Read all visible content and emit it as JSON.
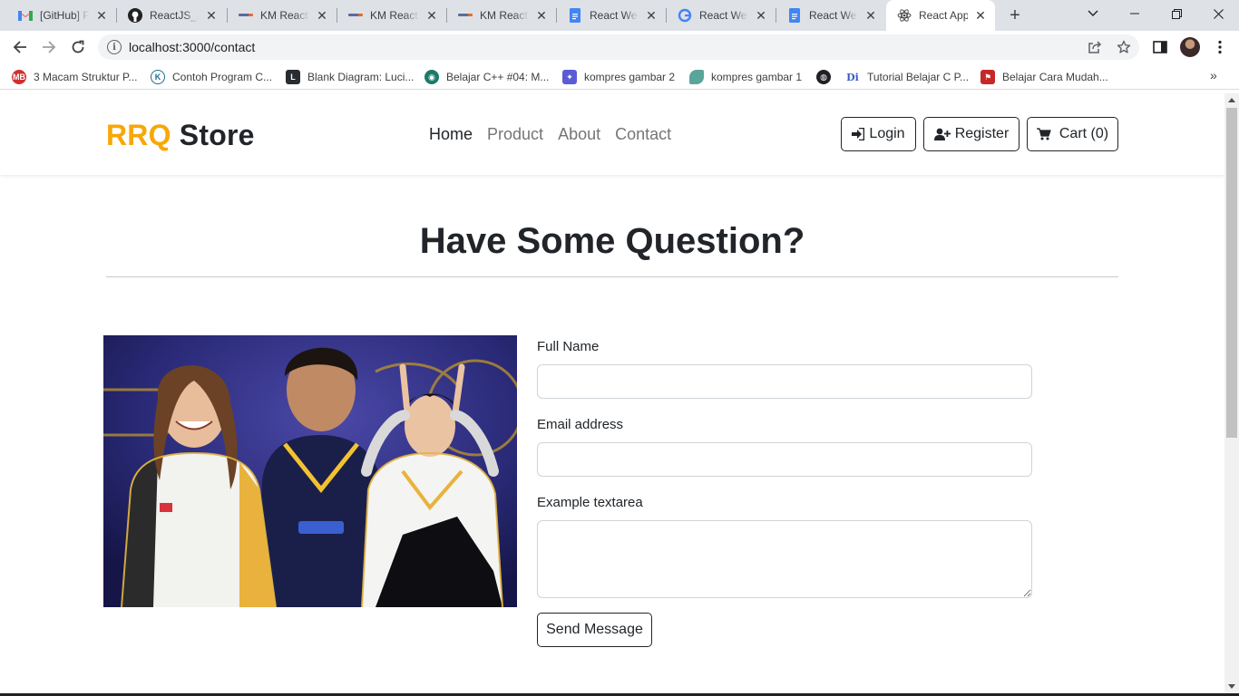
{
  "browser": {
    "tabs": [
      {
        "title": "[GitHub] P",
        "icon": "gmail-icon"
      },
      {
        "title": "ReactJS_Ar",
        "icon": "github-icon"
      },
      {
        "title": "KM React V",
        "icon": "site-logo-icon"
      },
      {
        "title": "KM React V",
        "icon": "site-logo-icon"
      },
      {
        "title": "KM React V",
        "icon": "site-logo-icon"
      },
      {
        "title": "React Wee",
        "icon": "google-docs-icon"
      },
      {
        "title": "React Wee",
        "icon": "google-icon"
      },
      {
        "title": "React Wee",
        "icon": "google-docs-icon"
      },
      {
        "title": "React App",
        "icon": "react-icon",
        "active": true
      }
    ],
    "url": "localhost:3000/contact",
    "bookmarks": [
      {
        "label": "3 Macam Struktur P...",
        "icon": "mb-icon"
      },
      {
        "label": "Contoh Program C...",
        "icon": "k-icon"
      },
      {
        "label": "Blank Diagram: Luci...",
        "icon": "lucid-icon"
      },
      {
        "label": "Belajar C++ #04: M...",
        "icon": "petani-icon"
      },
      {
        "label": "kompres gambar 2",
        "icon": "compress-icon"
      },
      {
        "label": "kompres gambar 1",
        "icon": "leaf-icon"
      },
      {
        "label": "",
        "icon": "globe-icon"
      },
      {
        "label": "Tutorial Belajar C P...",
        "icon": "di-icon"
      },
      {
        "label": "Belajar Cara Mudah...",
        "icon": "red-flag-icon"
      }
    ]
  },
  "site": {
    "brand_accent": "RRQ",
    "brand_rest": " Store",
    "nav": [
      {
        "label": "Home",
        "active": true
      },
      {
        "label": "Product",
        "active": false
      },
      {
        "label": "About",
        "active": false
      },
      {
        "label": "Contact",
        "active": false
      }
    ],
    "actions": {
      "login": "Login",
      "register": "Register",
      "cart": "Cart (0)"
    }
  },
  "contact": {
    "heading": "Have Some Question?",
    "full_name_label": "Full Name",
    "full_name_value": "",
    "email_label": "Email address",
    "email_value": "",
    "message_label": "Example textarea",
    "message_value": "",
    "submit_label": "Send Message"
  },
  "colors": {
    "brand_accent": "#f7a707",
    "text_dark": "#212529",
    "nav_muted": "#757575",
    "chrome_bg": "#dee1e6"
  }
}
